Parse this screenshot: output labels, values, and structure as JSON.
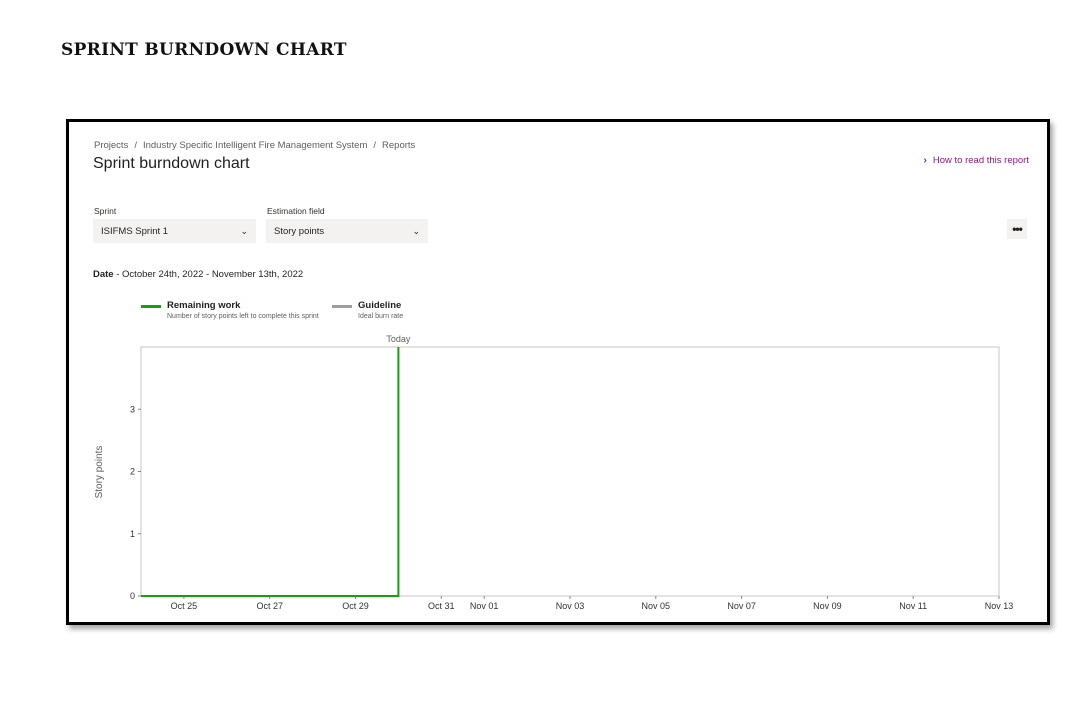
{
  "document": {
    "title": "SPRINT BURNDOWN CHART"
  },
  "breadcrumb": {
    "items": [
      "Projects",
      "Industry Specific Intelligent Fire Management System",
      "Reports"
    ],
    "separator": "/"
  },
  "page": {
    "title": "Sprint burndown chart",
    "help_link": "How to read this report"
  },
  "filters": {
    "sprint_label": "Sprint",
    "sprint_value": "ISIFMS Sprint 1",
    "estimation_label": "Estimation field",
    "estimation_value": "Story points"
  },
  "date_range": {
    "label": "Date",
    "separator": " - ",
    "value": "October 24th, 2022 - November 13th, 2022"
  },
  "legend": [
    {
      "title": "Remaining work",
      "subtitle": "Number of story points left to complete this sprint",
      "color": "#13a10e"
    },
    {
      "title": "Guideline",
      "subtitle": "Ideal burn rate",
      "color": "#a19f9d"
    }
  ],
  "icons": {
    "help_link": "chevron-right-icon",
    "dropdown": "chevron-down-icon",
    "more": "more-icon"
  },
  "chart_data": {
    "type": "line",
    "ylabel": "Story points",
    "xlabel": "",
    "ylim": [
      0,
      4
    ],
    "yticks": [
      0,
      1,
      2,
      3
    ],
    "xlim": [
      "2022-10-24",
      "2022-11-13"
    ],
    "xtick_labels": [
      {
        "date": "2022-10-25",
        "label": "Oct 25"
      },
      {
        "date": "2022-10-27",
        "label": "Oct 27"
      },
      {
        "date": "2022-10-29",
        "label": "Oct 29"
      },
      {
        "date": "2022-10-31",
        "label": "Oct 31"
      },
      {
        "date": "2022-11-01",
        "label": "Nov 01"
      },
      {
        "date": "2022-11-03",
        "label": "Nov 03"
      },
      {
        "date": "2022-11-05",
        "label": "Nov 05"
      },
      {
        "date": "2022-11-07",
        "label": "Nov 07"
      },
      {
        "date": "2022-11-09",
        "label": "Nov 09"
      },
      {
        "date": "2022-11-11",
        "label": "Nov 11"
      },
      {
        "date": "2022-11-13",
        "label": "Nov 13"
      }
    ],
    "today_label": "Today",
    "today": "2022-10-30",
    "series": [
      {
        "name": "Remaining work",
        "color": "#13a10e",
        "x": [
          "2022-10-24",
          "2022-10-30",
          "2022-10-30"
        ],
        "y": [
          0,
          0,
          4
        ]
      }
    ],
    "grid": false,
    "legend": "top-left"
  }
}
